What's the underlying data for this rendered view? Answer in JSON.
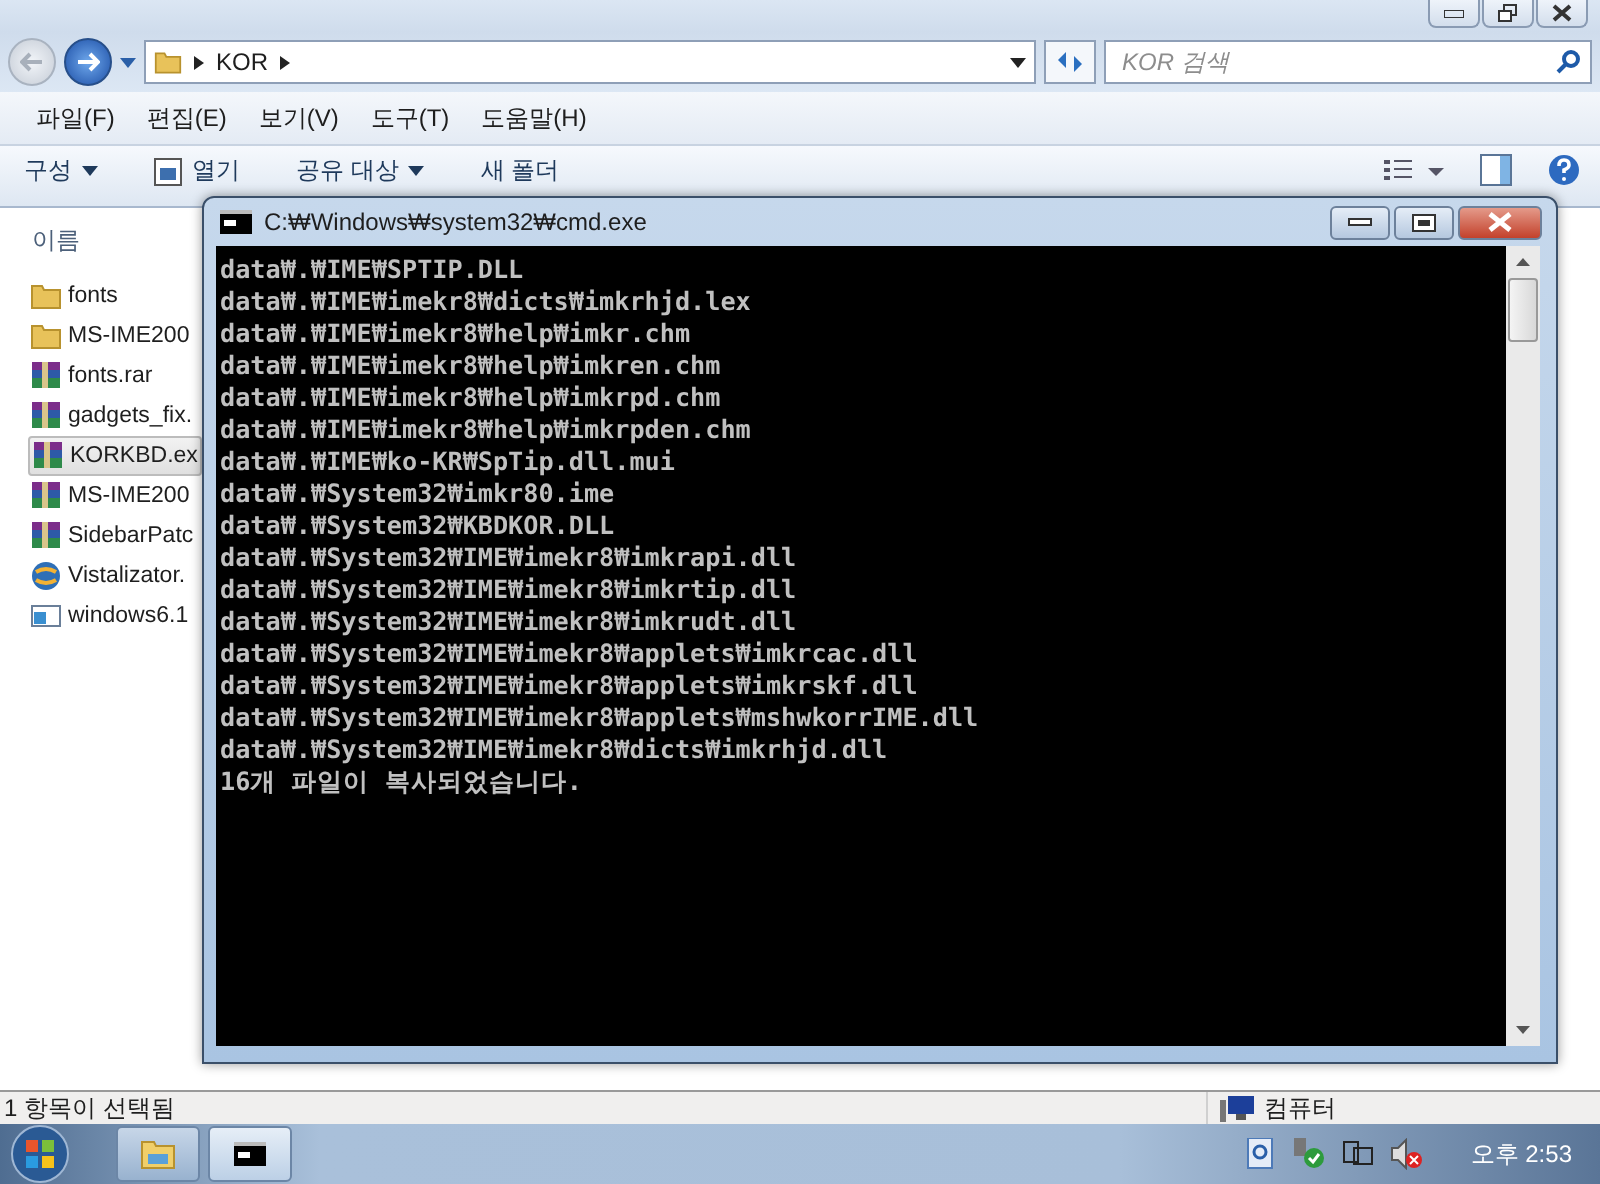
{
  "explorer": {
    "address": {
      "crumbs": [
        "KOR"
      ]
    },
    "search": {
      "placeholder": "KOR 검색"
    },
    "menu": [
      "파일(F)",
      "편집(E)",
      "보기(V)",
      "도구(T)",
      "도움말(H)"
    ],
    "toolbar": [
      {
        "label": "구성",
        "kind": "dropdown"
      },
      {
        "label": "열기",
        "kind": "icon"
      },
      {
        "label": "공유 대상",
        "kind": "dropdown"
      },
      {
        "label": "새 폴더",
        "kind": "plain"
      }
    ],
    "column_header": "이름",
    "files": [
      {
        "name": "fonts",
        "kind": "folder",
        "selected": false
      },
      {
        "name": "MS-IME200",
        "kind": "folder",
        "selected": false
      },
      {
        "name": "fonts.rar",
        "kind": "archive",
        "selected": false
      },
      {
        "name": "gadgets_fix.",
        "kind": "archive",
        "selected": false
      },
      {
        "name": "KORKBD.ex",
        "kind": "archive",
        "selected": true
      },
      {
        "name": "MS-IME200",
        "kind": "archive",
        "selected": false
      },
      {
        "name": "SidebarPatc",
        "kind": "archive",
        "selected": false
      },
      {
        "name": "Vistalizator.",
        "kind": "program",
        "selected": false
      },
      {
        "name": "windows6.1",
        "kind": "window",
        "selected": false
      }
    ],
    "status_bar": {
      "selection": "1 항목이 선택됨",
      "location": "컴퓨터"
    }
  },
  "cmd_window": {
    "title": "C:₩Windows₩system32₩cmd.exe",
    "lines": [
      "data₩.₩IME₩SPTIP.DLL",
      "data₩.₩IME₩imekr8₩dicts₩imkrhjd.lex",
      "data₩.₩IME₩imekr8₩help₩imkr.chm",
      "data₩.₩IME₩imekr8₩help₩imkren.chm",
      "data₩.₩IME₩imekr8₩help₩imkrpd.chm",
      "data₩.₩IME₩imekr8₩help₩imkrpden.chm",
      "data₩.₩IME₩ko-KR₩SpTip.dll.mui",
      "data₩.₩System32₩imkr80.ime",
      "data₩.₩System32₩KBDKOR.DLL",
      "data₩.₩System32₩IME₩imekr8₩imkrapi.dll",
      "data₩.₩System32₩IME₩imekr8₩imkrtip.dll",
      "data₩.₩System32₩IME₩imekr8₩imkrudt.dll",
      "data₩.₩System32₩IME₩imekr8₩applets₩imkrcac.dll",
      "data₩.₩System32₩IME₩imekr8₩applets₩imkrskf.dll",
      "data₩.₩System32₩IME₩imekr8₩applets₩mshwkorrIME.dll",
      "data₩.₩System32₩IME₩imekr8₩dicts₩imkrhjd.dll",
      "16개 파일이 복사되었습니다."
    ]
  },
  "taskbar": {
    "buttons": [
      {
        "kind": "explorer",
        "selected": false
      },
      {
        "kind": "cmd",
        "selected": true
      }
    ],
    "clock": "오후 2:53"
  }
}
